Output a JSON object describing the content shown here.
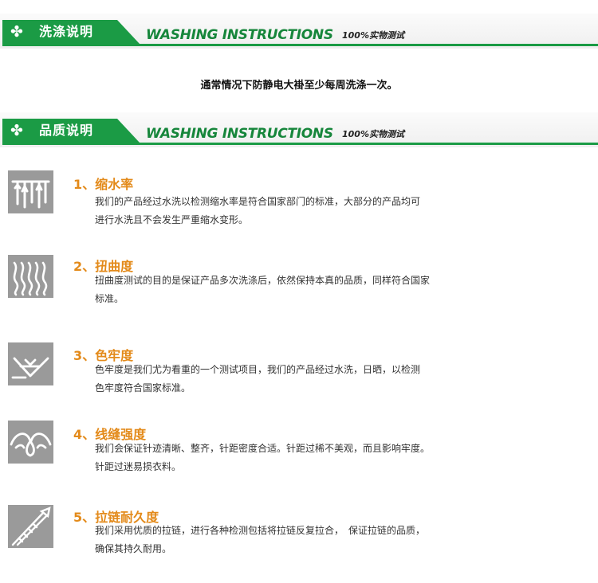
{
  "sections": [
    {
      "title_zh": "洗涤说明",
      "title_en": "WASHING INSTRUCTIONS",
      "subtitle": "100%实物测试",
      "icon": "clover-icon"
    },
    {
      "title_zh": "品质说明",
      "title_en": "WASHING INSTRUCTIONS",
      "subtitle": "100%实物测试",
      "icon": "clover-icon"
    }
  ],
  "washing_notice": "通常情况下防静电大褂至少每周洗涤一次。",
  "quality_items": [
    {
      "title": "1、缩水率",
      "icon": "shrinkage-icon",
      "lines": [
        "我们的产品经过水洗以检测缩水率是符合国家部门的标准，大部分的产品均可",
        "进行水洗且不会发生严重缩水变形。"
      ]
    },
    {
      "title": "2、扭曲度",
      "icon": "twist-icon",
      "lines": [
        "扭曲度测试的目的是保证产品多次洗涤后，依然保持本真的品质，同样符合国家",
        "标准。"
      ]
    },
    {
      "title": "3、色牢度",
      "icon": "color-fastness-icon",
      "lines": [
        "色牢度是我们尤为看重的一个测试项目，我们的产品经过水洗，日晒，以检测",
        "色牢度符合国家标准。"
      ]
    },
    {
      "title": "4、线缝强度",
      "icon": "seam-strength-icon",
      "lines": [
        "我们会保证针迹清晰、整齐，针距密度合适。针距过稀不美观，而且影响牢度。",
        "针距过迷易损衣料。"
      ]
    },
    {
      "title": "5、拉链耐久度",
      "icon": "zipper-icon",
      "lines": [
        "我们采用优质的拉链，进行各种检测包括将拉链反复拉合，　保证拉链的品质，",
        "确保其持久耐用。"
      ]
    }
  ]
}
